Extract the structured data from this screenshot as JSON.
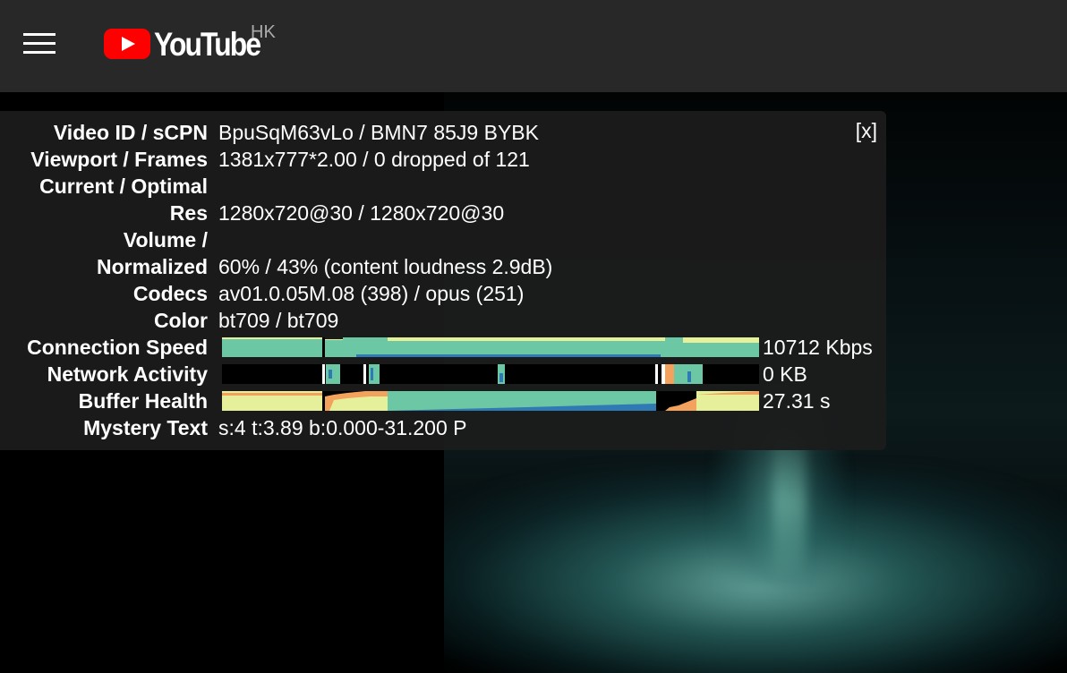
{
  "header": {
    "logo_text": "YouTube",
    "region": "HK"
  },
  "stats": {
    "close_label": "[x]",
    "rows": [
      {
        "label": "Video ID / sCPN",
        "value": "BpuSqM63vLo / BMN7 85J9 BYBK"
      },
      {
        "label": "Viewport / Frames",
        "value": "1381x777*2.00 / 0 dropped of 121"
      },
      {
        "label": "Current / Optimal",
        "value": ""
      },
      {
        "label": "Res",
        "value": "1280x720@30 / 1280x720@30"
      },
      {
        "label": "Volume /",
        "value": ""
      },
      {
        "label": "Normalized",
        "value": "60% / 43% (content loudness 2.9dB)"
      },
      {
        "label": "Codecs",
        "value": "av01.0.05M.08 (398) / opus (251)"
      },
      {
        "label": "Color",
        "value": "bt709 / bt709"
      },
      {
        "label": "Connection Speed",
        "value": "10712 Kbps"
      },
      {
        "label": "Network Activity",
        "value": "0 KB"
      },
      {
        "label": "Buffer Health",
        "value": "27.31 s"
      },
      {
        "label": "Mystery Text",
        "value": "s:4 t:3.89 b:0.000-31.200 P"
      }
    ]
  },
  "colors": {
    "teal": "#6cc7a4",
    "blue": "#2f79b5",
    "yellow": "#e6f09b",
    "orange": "#f2a25c",
    "header_bg": "#282828",
    "panel_bg": "#1c1c1c"
  },
  "icons": {
    "menu": "hamburger-menu-icon",
    "logo": "youtube-play-icon"
  }
}
